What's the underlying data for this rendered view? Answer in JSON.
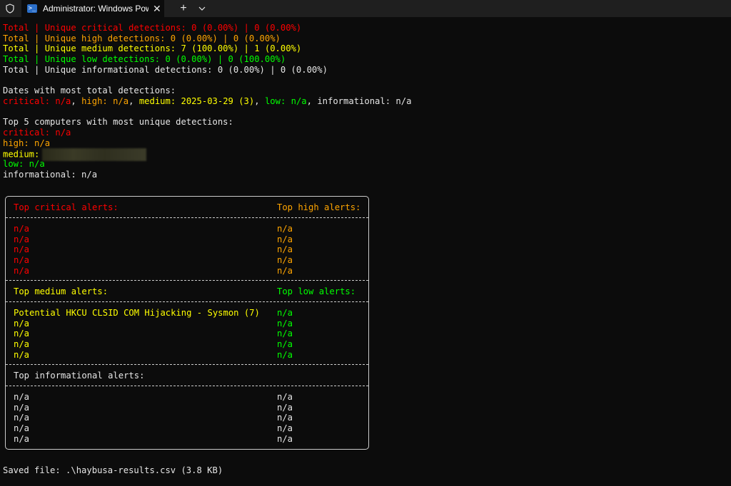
{
  "window": {
    "tab_title": "Administrator: Windows PowerShell",
    "ps_glyph": ">_",
    "close_glyph": "✕",
    "new_tab_glyph": "+"
  },
  "summary": {
    "critical": "Total | Unique critical detections: 0 (0.00%) | 0 (0.00%)",
    "high": "Total | Unique high detections: 0 (0.00%) | 0 (0.00%)",
    "medium": "Total | Unique medium detections: 7 (100.00%) | 1 (0.00%)",
    "low": "Total | Unique low detections: 0 (0.00%) | 0 (100.00%)",
    "informational": "Total | Unique informational detections: 0 (0.00%) | 0 (0.00%)"
  },
  "dates": {
    "heading": "Dates with most total detections:",
    "critical": "critical: n/a",
    "sep1": ", ",
    "high": "high: n/a",
    "sep2": ", ",
    "medium": "medium: 2025-03-29 (3)",
    "sep3": ", ",
    "low": "low: n/a",
    "sep4": ", ",
    "informational": "informational: n/a"
  },
  "computers": {
    "heading": "Top 5 computers with most unique detections:",
    "critical": "critical: n/a",
    "high": "high: n/a",
    "medium": "medium:",
    "low": "low: n/a",
    "informational": "informational: n/a"
  },
  "alerts": {
    "critical_header": "Top critical alerts:",
    "high_header": "Top high alerts:",
    "medium_header": "Top medium alerts:",
    "low_header": "Top low alerts:",
    "informational_header": "Top informational alerts:",
    "critical": [
      "n/a",
      "n/a",
      "n/a",
      "n/a",
      "n/a"
    ],
    "high": [
      "n/a",
      "n/a",
      "n/a",
      "n/a",
      "n/a"
    ],
    "medium": [
      "Potential HKCU CLSID COM Hijacking - Sysmon (7)",
      "n/a",
      "n/a",
      "n/a",
      "n/a"
    ],
    "low": [
      "n/a",
      "n/a",
      "n/a",
      "n/a",
      "n/a"
    ],
    "informational_left": [
      "n/a",
      "n/a",
      "n/a",
      "n/a",
      "n/a"
    ],
    "informational_right": [
      "n/a",
      "n/a",
      "n/a",
      "n/a",
      "n/a"
    ]
  },
  "footer": "Saved file: .\\haybusa-results.csv (3.8 KB)",
  "colors": {
    "critical": "#ff0000",
    "high": "#ffa500",
    "medium": "#ffff00",
    "low": "#00ff00",
    "informational": "#e6e6e6"
  }
}
